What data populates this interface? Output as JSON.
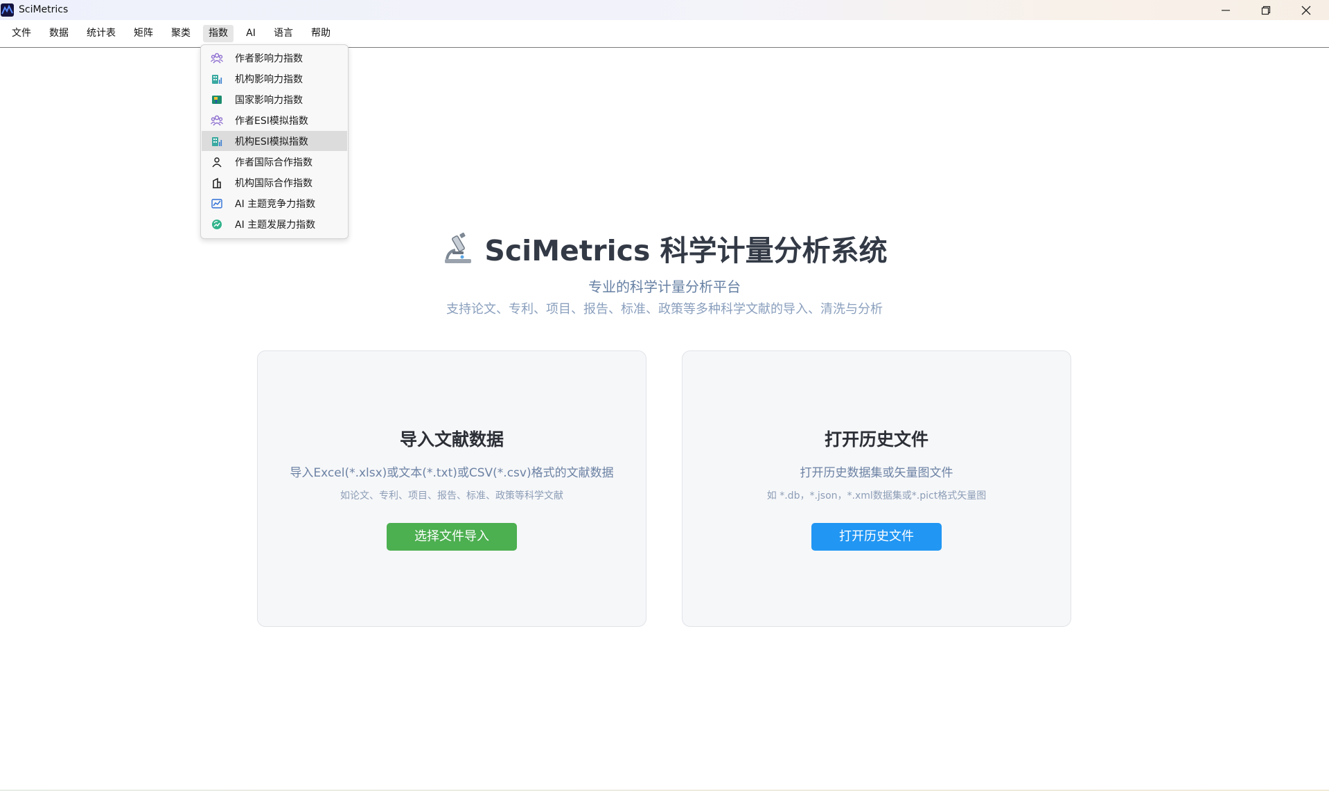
{
  "window": {
    "title": "SciMetrics"
  },
  "menubar": {
    "items": [
      {
        "label": "文件"
      },
      {
        "label": "数据"
      },
      {
        "label": "统计表"
      },
      {
        "label": "矩阵"
      },
      {
        "label": "聚类"
      },
      {
        "label": "指数"
      },
      {
        "label": "AI"
      },
      {
        "label": "语言"
      },
      {
        "label": "帮助"
      }
    ],
    "active": "指数"
  },
  "index_menu": {
    "items": [
      {
        "label": "作者影响力指数",
        "icon": "people-group-icon"
      },
      {
        "label": "机构影响力指数",
        "icon": "building-chart-icon"
      },
      {
        "label": "国家影响力指数",
        "icon": "flag-icon"
      },
      {
        "label": "作者ESI模拟指数",
        "icon": "people-group-icon"
      },
      {
        "label": "机构ESI模拟指数",
        "icon": "building-chart-icon"
      },
      {
        "label": "作者国际合作指数",
        "icon": "person-icon"
      },
      {
        "label": "机构国际合作指数",
        "icon": "building-icon"
      },
      {
        "label": "AI 主题竞争力指数",
        "icon": "line-chart-icon"
      },
      {
        "label": "AI 主题发展力指数",
        "icon": "growth-icon"
      }
    ],
    "hovered": "机构ESI模拟指数"
  },
  "hero": {
    "title": "SciMetrics 科学计量分析系统",
    "icon": "microscope-icon",
    "subtitle": "专业的科学计量分析平台",
    "description": "支持论文、专利、项目、报告、标准、政策等多种科学文献的导入、清洗与分析"
  },
  "import_card": {
    "title": "导入文献数据",
    "description": "导入Excel(*.xlsx)或文本(*.txt)或CSV(*.csv)格式的文献数据",
    "hint": "如论文、专利、项目、报告、标准、政策等科学文献",
    "button_label": "选择文件导入",
    "button_color": "#4caf50"
  },
  "history_card": {
    "title": "打开历史文件",
    "description": "打开历史数据集或矢量图文件",
    "hint": "如 *.db，*.json，*.xml数据集或*.pict格式矢量图",
    "button_label": "打开历史文件",
    "button_color": "#2196f3"
  }
}
